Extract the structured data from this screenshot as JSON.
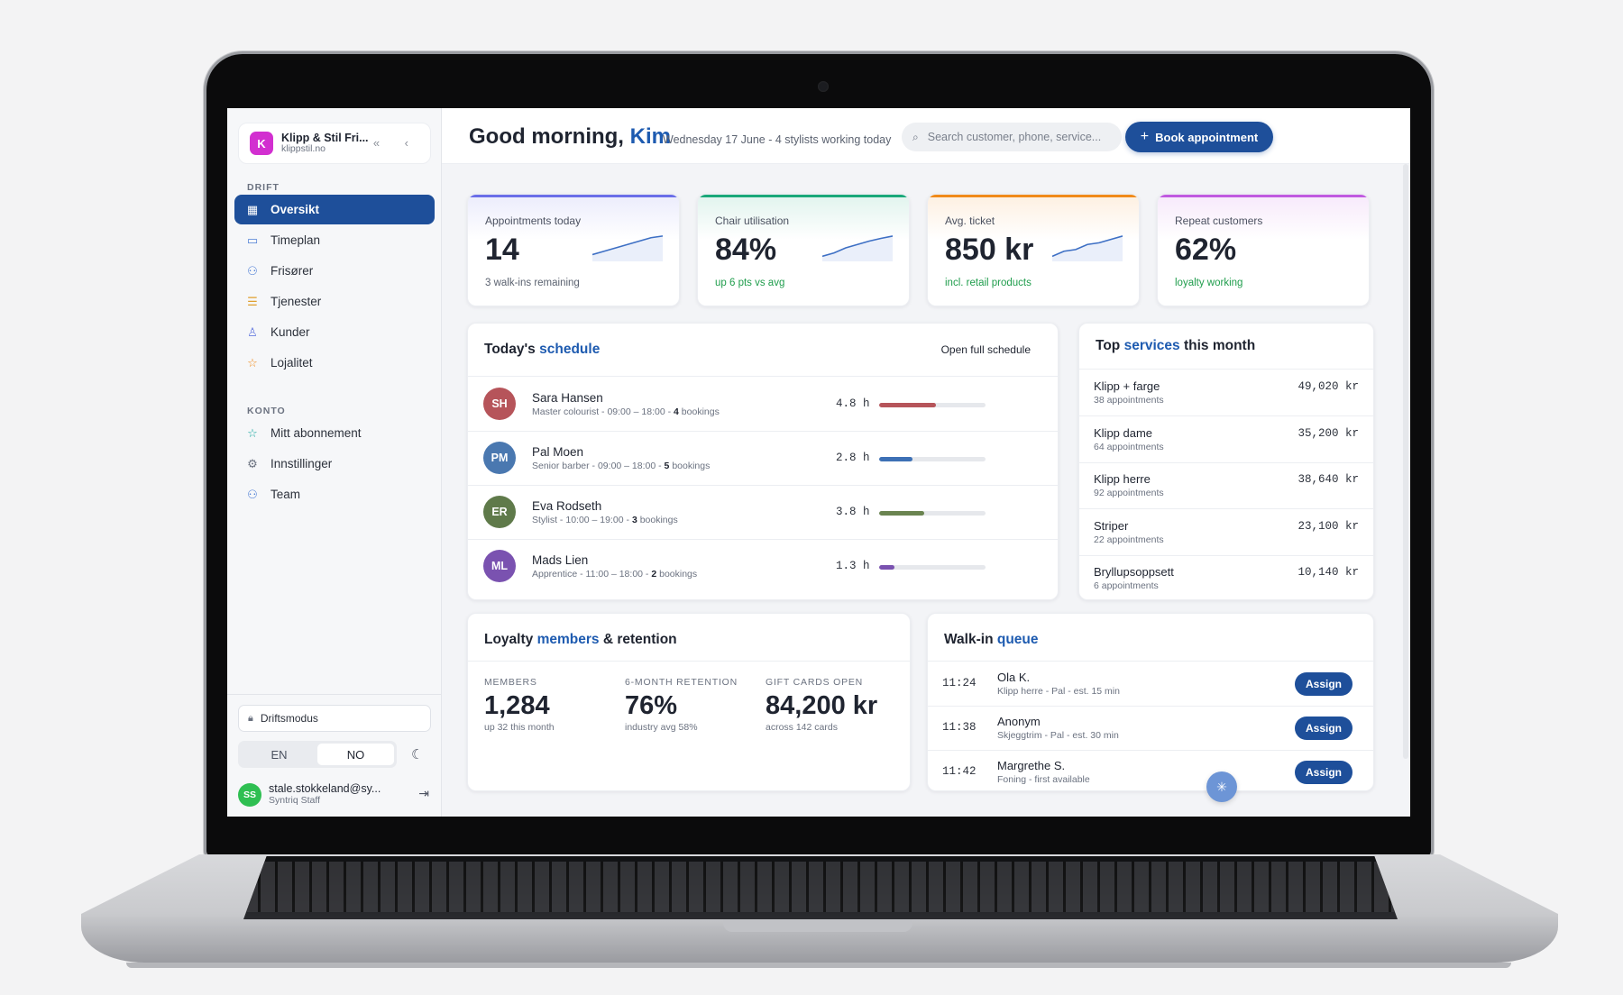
{
  "brand": {
    "name": "Klipp & Stil Fri...",
    "url": "klippstil.no",
    "logo_letter": "K",
    "collapse_glyphs": "« ‹"
  },
  "sidebar": {
    "drift_label": "DRIFT",
    "konto_label": "KONTO",
    "items": [
      {
        "label": "Oversikt",
        "icon": "grid-icon",
        "active": true
      },
      {
        "label": "Timeplan",
        "icon": "calendar-icon"
      },
      {
        "label": "Frisører",
        "icon": "users-icon"
      },
      {
        "label": "Tjenester",
        "icon": "list-icon"
      },
      {
        "label": "Kunder",
        "icon": "user-icon"
      },
      {
        "label": "Lojalitet",
        "icon": "star-icon"
      }
    ],
    "konto_items": [
      {
        "label": "Mitt abonnement",
        "icon": "star-outline-icon"
      },
      {
        "label": "Innstillinger",
        "icon": "gear-icon"
      },
      {
        "label": "Team",
        "icon": "team-icon"
      }
    ],
    "modus": "Driftsmodus",
    "lang": {
      "en": "EN",
      "no": "NO",
      "active": "NO"
    },
    "user": {
      "initials": "SS",
      "email": "stale.stokkeland@sy...",
      "role": "Syntriq Staff"
    }
  },
  "header": {
    "greeting": "Good morning,",
    "name": "Kim",
    "subtitle": "Wednesday 17 June - 4 stylists working today",
    "search_placeholder": "Search customer, phone, service...",
    "book_label": "Book appointment"
  },
  "kpis": [
    {
      "label": "Appointments today",
      "value": "14",
      "note": "3 walk-ins remaining",
      "color": "#6a6ee8",
      "trend": [
        2,
        3,
        4,
        5,
        6,
        7,
        7.5
      ]
    },
    {
      "label": "Chair utilisation",
      "value": "84%",
      "note": "up 6 pts vs avg",
      "color": "#1aa87a",
      "trend": [
        1.5,
        2.5,
        4,
        5,
        6,
        6.8,
        7.5
      ]
    },
    {
      "label": "Avg. ticket",
      "value": "850 kr",
      "note": "incl. retail products",
      "color": "#f08a1a",
      "trend": [
        1.5,
        3,
        3.5,
        5,
        5.5,
        6.5,
        7.5
      ]
    },
    {
      "label": "Repeat customers",
      "value": "62%",
      "note": "loyalty working",
      "color": "#c05ae0",
      "trend": []
    }
  ],
  "schedule": {
    "title_a": "Today's",
    "title_b": "schedule",
    "link": "Open full schedule",
    "rows": [
      {
        "initials": "SH",
        "name": "Sara Hansen",
        "role": "Master colourist",
        "hours_range": "09:00 – 18:00",
        "bookings": "4",
        "bookings_word": "bookings",
        "worked": "4.8 h",
        "fraction": 0.53,
        "color": "#b6545a",
        "bar": "#b6545a"
      },
      {
        "initials": "PM",
        "name": "Pal Moen",
        "role": "Senior barber",
        "hours_range": "09:00 – 18:00",
        "bookings": "5",
        "bookings_word": "bookings",
        "worked": "2.8 h",
        "fraction": 0.31,
        "color": "#4a78b0",
        "bar": "#3d70b5"
      },
      {
        "initials": "ER",
        "name": "Eva Rodseth",
        "role": "Stylist",
        "hours_range": "10:00 – 19:00",
        "bookings": "3",
        "bookings_word": "bookings",
        "worked": "3.8 h",
        "fraction": 0.42,
        "color": "#5f7a4a",
        "bar": "#6a8450"
      },
      {
        "initials": "ML",
        "name": "Mads Lien",
        "role": "Apprentice",
        "hours_range": "11:00 – 18:00",
        "bookings": "2",
        "bookings_word": "bookings",
        "worked": "1.3 h",
        "fraction": 0.14,
        "color": "#7a52b0",
        "bar": "#7a52b0"
      }
    ]
  },
  "services": {
    "title_a": "Top",
    "title_b": "services",
    "title_c": "this month",
    "rows": [
      {
        "name": "Klipp + farge",
        "count": "38 appointments",
        "amount": "49,020 kr"
      },
      {
        "name": "Klipp dame",
        "count": "64 appointments",
        "amount": "35,200 kr"
      },
      {
        "name": "Klipp herre",
        "count": "92 appointments",
        "amount": "38,640 kr"
      },
      {
        "name": "Striper",
        "count": "22 appointments",
        "amount": "23,100 kr"
      },
      {
        "name": "Bryllupsoppsett",
        "count": "6 appointments",
        "amount": "10,140 kr"
      }
    ]
  },
  "loyalty": {
    "title_a": "Loyalty",
    "title_b": "members",
    "title_c": "& retention",
    "stats": [
      {
        "label": "Members",
        "value": "1,284",
        "sub": "up 32 this month"
      },
      {
        "label": "6-month retention",
        "value": "76%",
        "sub": "industry avg 58%"
      },
      {
        "label": "Gift cards open",
        "value": "84,200 kr",
        "sub": "across 142 cards"
      }
    ]
  },
  "walkin": {
    "title_a": "Walk-in",
    "title_b": "queue",
    "assign": "Assign",
    "rows": [
      {
        "time": "11:24",
        "name": "Ola K.",
        "detail": "Klipp herre - Pal - est. 15 min"
      },
      {
        "time": "11:38",
        "name": "Anonym",
        "detail": "Skjeggtrim - Pal - est. 30 min"
      },
      {
        "time": "11:42",
        "name": "Margrethe S.",
        "detail": "Foning - first available"
      }
    ]
  },
  "fab_icon": "sparkle-icon"
}
